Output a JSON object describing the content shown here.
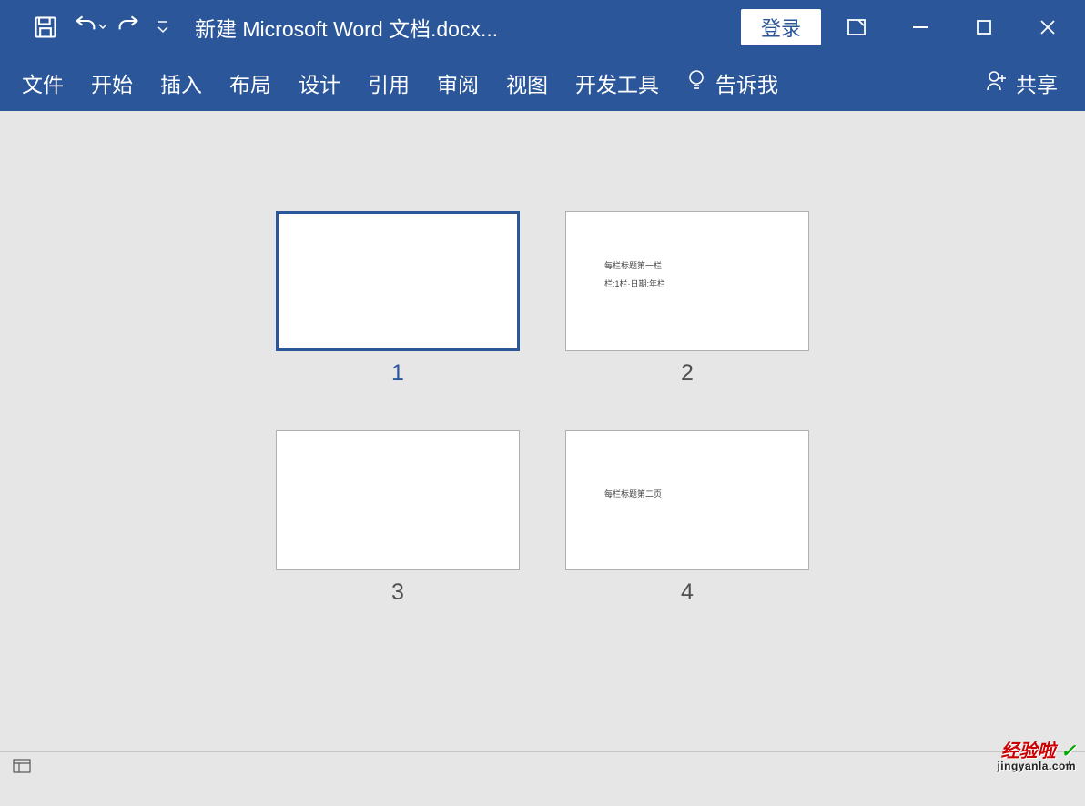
{
  "titlebar": {
    "document_title": "新建 Microsoft Word 文档.docx...",
    "login_label": "登录"
  },
  "ribbon": {
    "tabs": [
      "文件",
      "开始",
      "插入",
      "布局",
      "设计",
      "引用",
      "审阅",
      "视图",
      "开发工具"
    ],
    "tell_me": "告诉我",
    "share": "共享"
  },
  "thumbnails": {
    "pages": [
      {
        "number": "1",
        "selected": true,
        "content_lines": []
      },
      {
        "number": "2",
        "selected": false,
        "content_lines": [
          "每栏标题第一栏",
          "栏:1栏·日期:年栏"
        ]
      },
      {
        "number": "3",
        "selected": false,
        "content_lines": []
      },
      {
        "number": "4",
        "selected": false,
        "content_lines": [
          "每栏标题第二页"
        ]
      }
    ]
  },
  "statusbar": {
    "zoom_minus": "−",
    "zoom_plus": "+"
  },
  "watermark": {
    "brand_cn": "经验啦",
    "check": "✓",
    "domain": "jingyanla.com"
  }
}
